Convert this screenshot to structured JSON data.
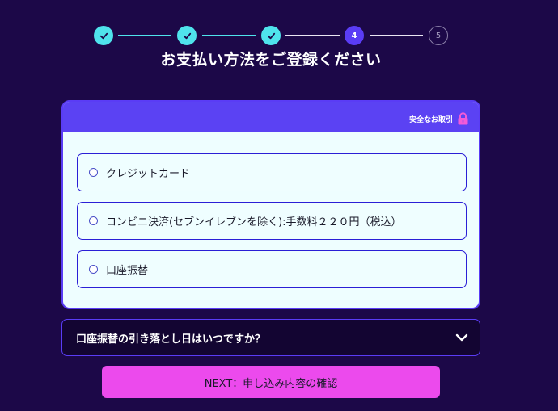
{
  "stepper": {
    "steps": [
      {
        "state": "done",
        "label": ""
      },
      {
        "state": "done",
        "label": ""
      },
      {
        "state": "done",
        "label": ""
      },
      {
        "state": "current",
        "label": "4"
      },
      {
        "state": "upcoming",
        "label": "5"
      }
    ],
    "colors": {
      "done": "#4fe3ec",
      "current": "#5a3cf5",
      "pending_line": "#e9e5f2"
    }
  },
  "page": {
    "title": "お支払い方法をご登録ください"
  },
  "card": {
    "secure_label": "安全なお取引",
    "lock_icon": "lock-icon",
    "options": [
      {
        "label": "クレジットカード"
      },
      {
        "label": "コンビニ決済(セブンイレブンを除く):手数料２２０円（税込）"
      },
      {
        "label": "口座振替"
      }
    ]
  },
  "faq": {
    "question": "口座振替の引き落とし日はいつですか？",
    "icon": "chevron-down-icon"
  },
  "next_button": {
    "label": "NEXT：申し込み内容の確認",
    "color": "#ec4aed"
  },
  "colors": {
    "background": "#1c0848",
    "accent": "#5a3cf5",
    "card_background": "#eefeff"
  }
}
